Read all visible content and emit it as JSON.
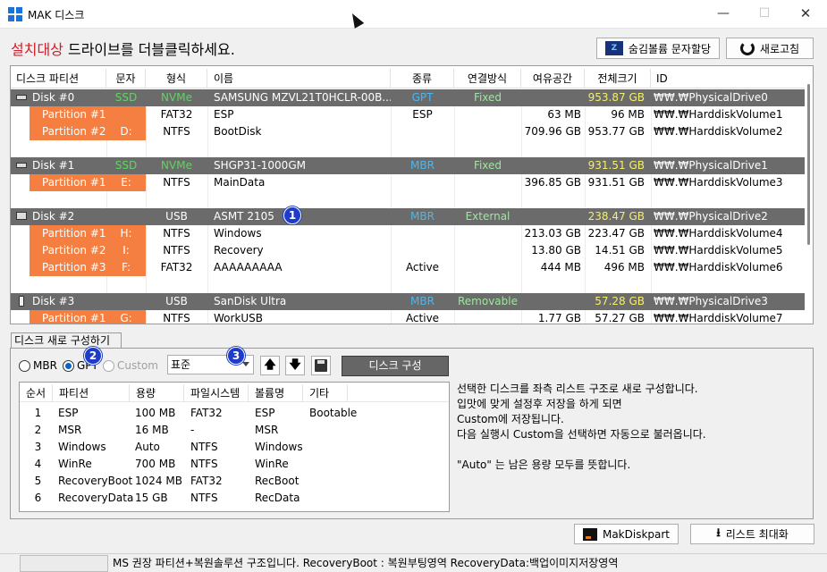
{
  "window": {
    "title": "MAK 디스크",
    "min_glyph": "—",
    "max_glyph": "☐",
    "close_glyph": "✕"
  },
  "heading": {
    "highlight": "설치대상",
    "rest": " 드라이브를 더블클릭하세요."
  },
  "toolbar": {
    "alloc_label": "숨김볼륨 문자할당",
    "refresh_label": "새로고침",
    "alloc_icon_text": "Z"
  },
  "disk_list": {
    "columns": [
      "디스크 파티션",
      "문자",
      "형식",
      "이름",
      "종류",
      "연결방식",
      "여유공간",
      "전체크기",
      "ID"
    ],
    "rows": [
      {
        "kind": "disk",
        "icon": "hdd-icon",
        "name": "Disk #0",
        "letter": "SSD",
        "format": "NVMe",
        "label": "SAMSUNG MZVL21T0HCLR-00B...",
        "type": "GPT",
        "conn": "Fixed",
        "free": "",
        "total": "953.87 GB",
        "id": "₩₩.₩PhysicalDrive0"
      },
      {
        "kind": "part",
        "name": "Partition #1",
        "letter": "",
        "format": "FAT32",
        "label": "ESP",
        "type": "ESP",
        "conn": "",
        "free": "63 MB",
        "total": "96 MB",
        "id": "₩₩.₩HarddiskVolume1"
      },
      {
        "kind": "part",
        "name": "Partition #2",
        "letter": "D:",
        "format": "NTFS",
        "label": "BootDisk",
        "type": "",
        "conn": "",
        "free": "709.96 GB",
        "total": "953.77 GB",
        "id": "₩₩.₩HarddiskVolume2"
      },
      {
        "kind": "blank"
      },
      {
        "kind": "disk",
        "icon": "hdd-icon",
        "name": "Disk #1",
        "letter": "SSD",
        "format": "NVMe",
        "label": "SHGP31-1000GM",
        "type": "MBR",
        "conn": "Fixed",
        "free": "",
        "total": "931.51 GB",
        "id": "₩₩.₩PhysicalDrive1"
      },
      {
        "kind": "part",
        "name": "Partition #1",
        "letter": "E:",
        "format": "NTFS",
        "label": "MainData",
        "type": "",
        "conn": "",
        "free": "396.85 GB",
        "total": "931.51 GB",
        "id": "₩₩.₩HarddiskVolume3"
      },
      {
        "kind": "blank"
      },
      {
        "kind": "disk",
        "icon": "usb-drive-icon",
        "name": "Disk #2",
        "letter": "",
        "format": "USB",
        "label": "ASMT 2105",
        "type": "MBR",
        "conn": "External",
        "free": "",
        "total": "238.47 GB",
        "id": "₩₩.₩PhysicalDrive2"
      },
      {
        "kind": "part",
        "name": "Partition #1",
        "letter": "H:",
        "format": "NTFS",
        "label": "Windows",
        "type": "",
        "conn": "",
        "free": "213.03 GB",
        "total": "223.47 GB",
        "id": "₩₩.₩HarddiskVolume4"
      },
      {
        "kind": "part",
        "name": "Partition #2",
        "letter": "I:",
        "format": "NTFS",
        "label": "Recovery",
        "type": "",
        "conn": "",
        "free": "13.80 GB",
        "total": "14.51 GB",
        "id": "₩₩.₩HarddiskVolume5"
      },
      {
        "kind": "part",
        "name": "Partition #3",
        "letter": "F:",
        "format": "FAT32",
        "label": "AAAAAAAAA",
        "type": "Active",
        "conn": "",
        "free": "444 MB",
        "total": "496 MB",
        "id": "₩₩.₩HarddiskVolume6"
      },
      {
        "kind": "blank"
      },
      {
        "kind": "disk",
        "icon": "usb-stick-icon",
        "name": "Disk #3",
        "letter": "",
        "format": "USB",
        "label": "SanDisk Ultra",
        "type": "MBR",
        "conn": "Removable",
        "free": "",
        "total": "57.28 GB",
        "id": "₩₩.₩PhysicalDrive3"
      },
      {
        "kind": "part",
        "name": "Partition #1",
        "letter": "G:",
        "format": "NTFS",
        "label": "WorkUSB",
        "type": "Active",
        "conn": "",
        "free": "1.77 GB",
        "total": "57.27 GB",
        "id": "₩₩.₩HarddiskVolume7"
      }
    ]
  },
  "markers": [
    "1",
    "2",
    "3"
  ],
  "compose_group": {
    "title": "디스크 새로 구성하기",
    "radio": [
      {
        "label": "MBR"
      },
      {
        "label": "GPT"
      },
      {
        "label": "Custom"
      }
    ],
    "preset_value": "표준",
    "up_glyph": "🡅",
    "down_glyph": "🡇",
    "compose_label": "디스크 구성",
    "columns": [
      "순서",
      "파티션",
      "용량",
      "파일시스템",
      "볼륨명",
      "기타"
    ],
    "partitions": [
      {
        "no": "1",
        "part": "ESP",
        "size": "100 MB",
        "fs": "FAT32",
        "vol": "ESP",
        "etc": "Bootable"
      },
      {
        "no": "2",
        "part": "MSR",
        "size": "16 MB",
        "fs": "-",
        "vol": "MSR",
        "etc": ""
      },
      {
        "no": "3",
        "part": "Windows",
        "size": "Auto",
        "fs": "NTFS",
        "vol": "Windows",
        "etc": ""
      },
      {
        "no": "4",
        "part": "WinRe",
        "size": "700 MB",
        "fs": "NTFS",
        "vol": "WinRe",
        "etc": ""
      },
      {
        "no": "5",
        "part": "RecoveryBoot",
        "size": "1024 MB",
        "fs": "FAT32",
        "vol": "RecBoot",
        "etc": ""
      },
      {
        "no": "6",
        "part": "RecoveryData",
        "size": "15 GB",
        "fs": "NTFS",
        "vol": "RecData",
        "etc": ""
      }
    ],
    "description": [
      "선택한 디스크를 좌측 리스트 구조로 새로 구성합니다.",
      "입맛에 맞게 설정후 저장을 하게 되면",
      "Custom에 저장됩니다.",
      "다음 실행시 Custom을 선택하면 자동으로 불러옵니다.",
      "",
      "\"Auto\" 는 남은 용량 모두를 뜻합니다."
    ]
  },
  "bottom": {
    "makdiskpart_label": "MakDiskpart",
    "maxlist_label": "리스트 최대화",
    "down_glyph": "⭳"
  },
  "statusbar": {
    "text": "MS 권장 파티션+복원솔루션 구조입니다. RecoveryBoot : 복원부팅영역 RecoveryData:백업이미지저장영역"
  }
}
